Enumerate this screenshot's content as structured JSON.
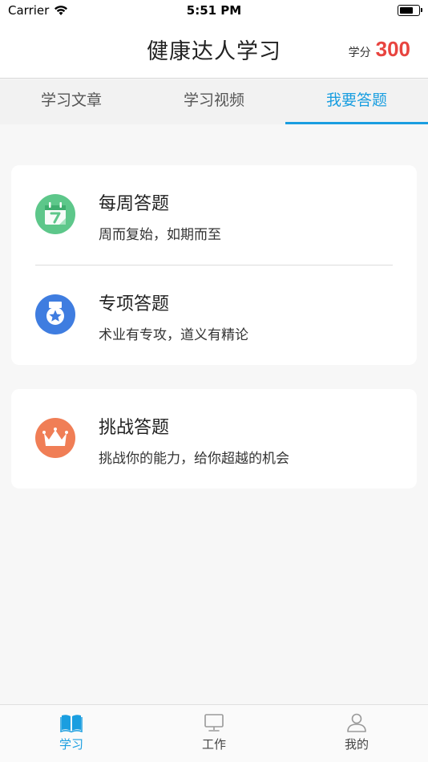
{
  "status_bar": {
    "carrier": "Carrier",
    "time": "5:51 PM"
  },
  "nav": {
    "title": "健康达人学习",
    "score_label": "学分",
    "score_value": "300"
  },
  "tabs": [
    {
      "label": "学习文章",
      "active": false
    },
    {
      "label": "学习视频",
      "active": false
    },
    {
      "label": "我要答题",
      "active": true
    }
  ],
  "quiz_items": [
    {
      "title": "每周答题",
      "subtitle": "周而复始，如期而至",
      "icon": "calendar-icon",
      "color": "#5dc78a"
    },
    {
      "title": "专项答题",
      "subtitle": "术业有专攻，道义有精论",
      "icon": "medal-star-icon",
      "color": "#3f7de0"
    },
    {
      "title": "挑战答题",
      "subtitle": "挑战你的能力，给你超越的机会",
      "icon": "crown-icon",
      "color": "#f07e56"
    }
  ],
  "bottom_tabs": [
    {
      "label": "学习",
      "icon": "book-icon",
      "active": true
    },
    {
      "label": "工作",
      "icon": "monitor-icon",
      "active": false
    },
    {
      "label": "我的",
      "icon": "person-icon",
      "active": false
    }
  ],
  "colors": {
    "accent": "#1a9ee0",
    "score": "#e8443f"
  }
}
